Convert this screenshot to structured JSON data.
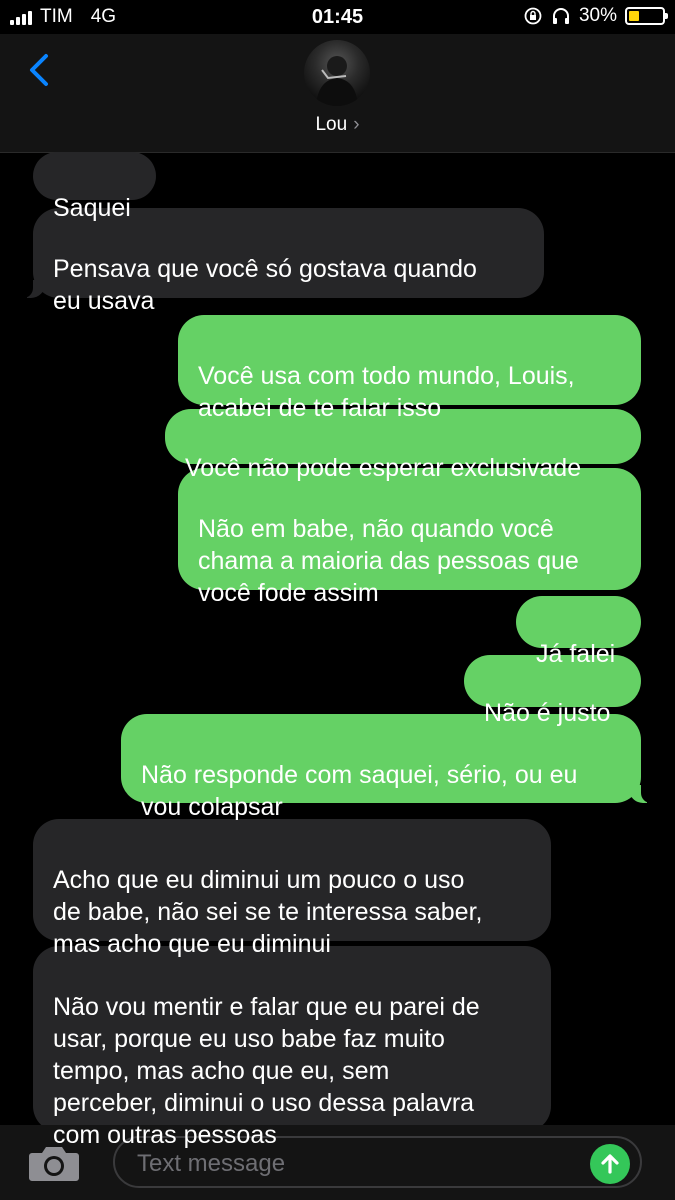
{
  "status_bar": {
    "carrier": "TIM",
    "network": "4G",
    "time": "01:45",
    "battery_percent": "30%",
    "battery_level": 0.3
  },
  "header": {
    "contact_name": "Lou"
  },
  "messages": [
    {
      "direction": "incoming",
      "text": "Saquei"
    },
    {
      "direction": "incoming",
      "text": "Pensava que você só gostava quando\neu usava"
    },
    {
      "direction": "outgoing",
      "text": "Você usa com todo mundo, Louis,\nacabei de te falar isso"
    },
    {
      "direction": "outgoing",
      "text": "Você não pode esperar exclusivade"
    },
    {
      "direction": "outgoing",
      "text": "Não em babe, não quando você\nchama a maioria das pessoas que\nvocê fode assim"
    },
    {
      "direction": "outgoing",
      "text": "Já falei"
    },
    {
      "direction": "outgoing",
      "text": "Não é justo"
    },
    {
      "direction": "outgoing",
      "text": "Não responde com saquei, sério, ou eu\nvou colapsar"
    },
    {
      "direction": "incoming",
      "text": "Acho que eu diminui um pouco o uso\nde babe, não sei se te interessa saber,\nmas acho que eu diminui"
    },
    {
      "direction": "incoming",
      "text": "Não vou mentir e falar que eu parei de\nusar, porque eu uso babe faz muito\ntempo, mas acho que eu, sem\nperceber, diminui o uso dessa palavra\ncom outras pessoas"
    }
  ],
  "composer": {
    "placeholder": "Text message"
  },
  "icons": {
    "back": "chevron-left-icon",
    "camera": "camera-icon",
    "send": "arrow-up-icon",
    "contact_chevron": "chevron-right-icon"
  },
  "colors": {
    "outgoing_bubble": "#65d165",
    "incoming_bubble": "#262628",
    "accent": "#0a84ff",
    "battery": "#ffd60a"
  }
}
